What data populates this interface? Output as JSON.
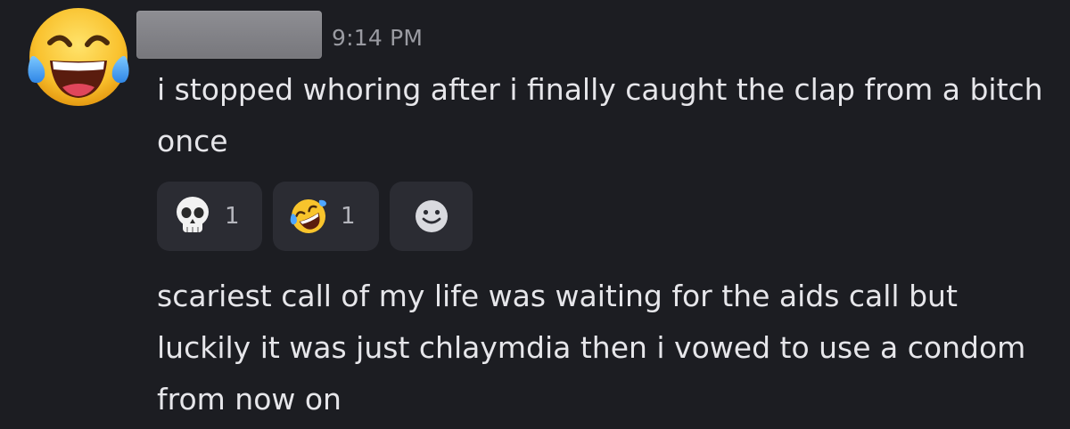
{
  "message_group": {
    "author": {
      "avatar_icon": "face-with-tears-of-joy-icon",
      "name_redacted": true
    },
    "timestamp": "9:14 PM",
    "messages": [
      {
        "text": "i stopped whoring after i finally caught the clap from a bitch once"
      },
      {
        "text": "scariest call of my life was waiting for the aids call but luckily it was just chlaymdia then i vowed to use a condom from now on"
      }
    ],
    "reactions": [
      {
        "emoji_icon": "skull-icon",
        "count": "1"
      },
      {
        "emoji_icon": "rolling-on-the-floor-laughing-icon",
        "count": "1"
      }
    ],
    "add_reaction_icon": "add-reaction-smiley-icon"
  },
  "colors": {
    "background": "#1c1d22",
    "text": "#e6e6ea",
    "timestamp": "#9a9ba2",
    "reaction_pill": "#2b2c33",
    "reaction_count": "#b5b6bd"
  }
}
